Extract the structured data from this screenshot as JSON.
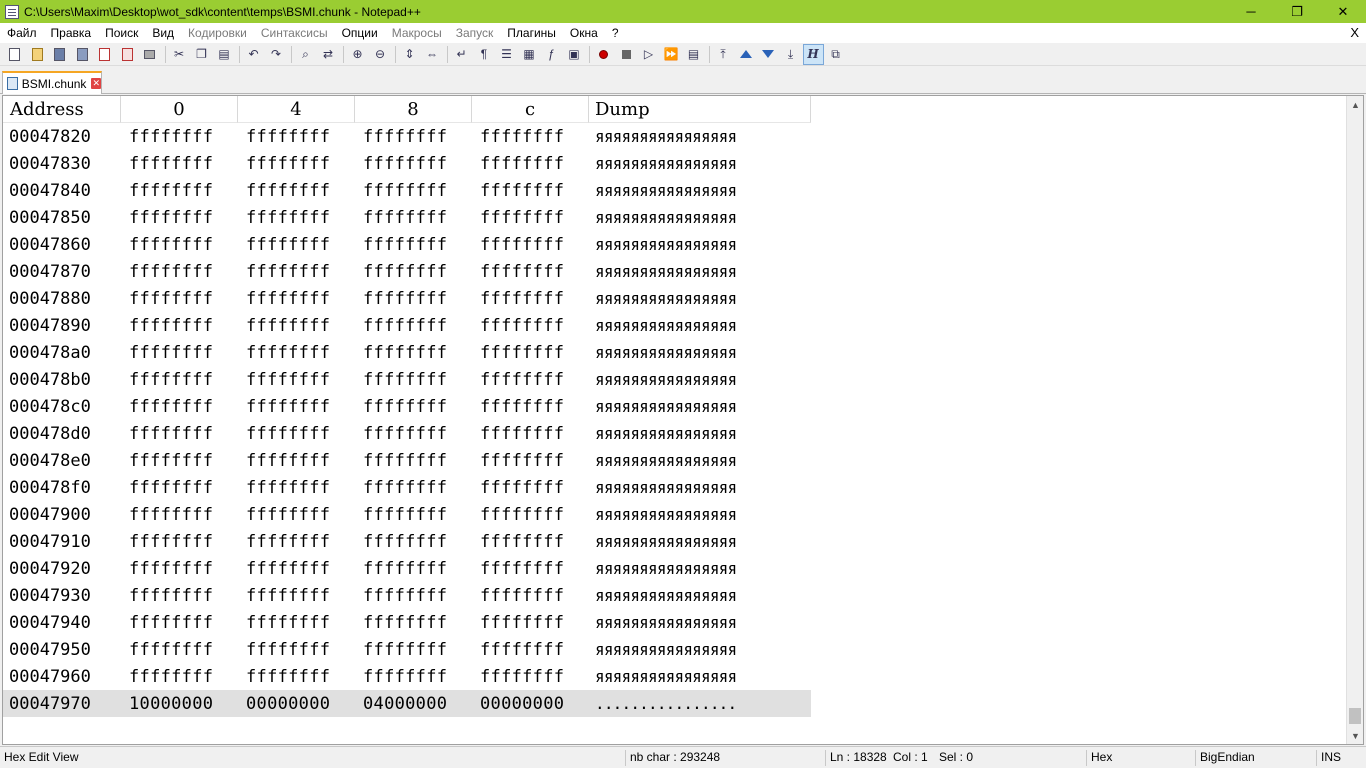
{
  "window": {
    "title": "C:\\Users\\Maxim\\Desktop\\wot_sdk\\content\\temps\\BSMI.chunk - Notepad++",
    "minimize": "─",
    "maximize": "❐",
    "close": "✕"
  },
  "menu": {
    "items": [
      {
        "label": "Файл",
        "enabled": true
      },
      {
        "label": "Правка",
        "enabled": true
      },
      {
        "label": "Поиск",
        "enabled": true
      },
      {
        "label": "Вид",
        "enabled": true
      },
      {
        "label": "Кодировки",
        "enabled": false
      },
      {
        "label": "Синтаксисы",
        "enabled": false
      },
      {
        "label": "Опции",
        "enabled": true
      },
      {
        "label": "Макросы",
        "enabled": false
      },
      {
        "label": "Запуск",
        "enabled": false
      },
      {
        "label": "Плагины",
        "enabled": true
      },
      {
        "label": "Окна",
        "enabled": true
      },
      {
        "label": "?",
        "enabled": true
      }
    ],
    "close_doc": "X"
  },
  "toolbar": {
    "icons": [
      "new-icon",
      "open-icon",
      "save-icon",
      "save-all-icon",
      "close-icon",
      "close-all-icon",
      "print-icon",
      "cut-icon",
      "copy-icon",
      "paste-icon",
      "undo-icon",
      "redo-icon",
      "find-icon",
      "replace-icon",
      "zoom-in-icon",
      "zoom-out-icon",
      "sync-vertical-icon",
      "sync-horizontal-icon",
      "word-wrap-icon",
      "show-all-chars-icon",
      "indent-guide-icon",
      "doc-map-icon",
      "function-list-icon",
      "folder-workspace-icon",
      "record-macro-icon",
      "stop-macro-icon",
      "play-macro-icon",
      "run-macro-multiple-icon",
      "save-macro-icon",
      "hex-first-icon",
      "hex-up-icon",
      "hex-down-icon",
      "hex-last-icon",
      "hex-edit-icon",
      "hex-compare-icon"
    ],
    "active": "hex-edit-icon"
  },
  "tab": {
    "label": "BSMI.chunk",
    "close": "✕"
  },
  "hex": {
    "headers": {
      "address": "Address",
      "col0": "0",
      "col4": "4",
      "col8": "8",
      "colc": "c",
      "dump": "Dump"
    },
    "rows": [
      {
        "addr": "00047820",
        "c0": "ffffffff",
        "c4": "ffffffff",
        "c8": "ffffffff",
        "cc": "ffffffff",
        "dump": "яяяяяяяяяяяяяяяя"
      },
      {
        "addr": "00047830",
        "c0": "ffffffff",
        "c4": "ffffffff",
        "c8": "ffffffff",
        "cc": "ffffffff",
        "dump": "яяяяяяяяяяяяяяяя"
      },
      {
        "addr": "00047840",
        "c0": "ffffffff",
        "c4": "ffffffff",
        "c8": "ffffffff",
        "cc": "ffffffff",
        "dump": "яяяяяяяяяяяяяяяя"
      },
      {
        "addr": "00047850",
        "c0": "ffffffff",
        "c4": "ffffffff",
        "c8": "ffffffff",
        "cc": "ffffffff",
        "dump": "яяяяяяяяяяяяяяяя"
      },
      {
        "addr": "00047860",
        "c0": "ffffffff",
        "c4": "ffffffff",
        "c8": "ffffffff",
        "cc": "ffffffff",
        "dump": "яяяяяяяяяяяяяяяя"
      },
      {
        "addr": "00047870",
        "c0": "ffffffff",
        "c4": "ffffffff",
        "c8": "ffffffff",
        "cc": "ffffffff",
        "dump": "яяяяяяяяяяяяяяяя"
      },
      {
        "addr": "00047880",
        "c0": "ffffffff",
        "c4": "ffffffff",
        "c8": "ffffffff",
        "cc": "ffffffff",
        "dump": "яяяяяяяяяяяяяяяя"
      },
      {
        "addr": "00047890",
        "c0": "ffffffff",
        "c4": "ffffffff",
        "c8": "ffffffff",
        "cc": "ffffffff",
        "dump": "яяяяяяяяяяяяяяяя"
      },
      {
        "addr": "000478a0",
        "c0": "ffffffff",
        "c4": "ffffffff",
        "c8": "ffffffff",
        "cc": "ffffffff",
        "dump": "яяяяяяяяяяяяяяяя"
      },
      {
        "addr": "000478b0",
        "c0": "ffffffff",
        "c4": "ffffffff",
        "c8": "ffffffff",
        "cc": "ffffffff",
        "dump": "яяяяяяяяяяяяяяяя"
      },
      {
        "addr": "000478c0",
        "c0": "ffffffff",
        "c4": "ffffffff",
        "c8": "ffffffff",
        "cc": "ffffffff",
        "dump": "яяяяяяяяяяяяяяяя"
      },
      {
        "addr": "000478d0",
        "c0": "ffffffff",
        "c4": "ffffffff",
        "c8": "ffffffff",
        "cc": "ffffffff",
        "dump": "яяяяяяяяяяяяяяяя"
      },
      {
        "addr": "000478e0",
        "c0": "ffffffff",
        "c4": "ffffffff",
        "c8": "ffffffff",
        "cc": "ffffffff",
        "dump": "яяяяяяяяяяяяяяяя"
      },
      {
        "addr": "000478f0",
        "c0": "ffffffff",
        "c4": "ffffffff",
        "c8": "ffffffff",
        "cc": "ffffffff",
        "dump": "яяяяяяяяяяяяяяяя"
      },
      {
        "addr": "00047900",
        "c0": "ffffffff",
        "c4": "ffffffff",
        "c8": "ffffffff",
        "cc": "ffffffff",
        "dump": "яяяяяяяяяяяяяяяя"
      },
      {
        "addr": "00047910",
        "c0": "ffffffff",
        "c4": "ffffffff",
        "c8": "ffffffff",
        "cc": "ffffffff",
        "dump": "яяяяяяяяяяяяяяяя"
      },
      {
        "addr": "00047920",
        "c0": "ffffffff",
        "c4": "ffffffff",
        "c8": "ffffffff",
        "cc": "ffffffff",
        "dump": "яяяяяяяяяяяяяяяя"
      },
      {
        "addr": "00047930",
        "c0": "ffffffff",
        "c4": "ffffffff",
        "c8": "ffffffff",
        "cc": "ffffffff",
        "dump": "яяяяяяяяяяяяяяяя"
      },
      {
        "addr": "00047940",
        "c0": "ffffffff",
        "c4": "ffffffff",
        "c8": "ffffffff",
        "cc": "ffffffff",
        "dump": "яяяяяяяяяяяяяяяя"
      },
      {
        "addr": "00047950",
        "c0": "ffffffff",
        "c4": "ffffffff",
        "c8": "ffffffff",
        "cc": "ffffffff",
        "dump": "яяяяяяяяяяяяяяяя"
      },
      {
        "addr": "00047960",
        "c0": "ffffffff",
        "c4": "ffffffff",
        "c8": "ffffffff",
        "cc": "ffffffff",
        "dump": "яяяяяяяяяяяяяяяя"
      },
      {
        "addr": "00047970",
        "c0": "10000000",
        "c4": "00000000",
        "c8": "04000000",
        "cc": "00000000",
        "dump": "................",
        "selected": true
      }
    ]
  },
  "status": {
    "mode": "Hex Edit View",
    "nb_char": "nb char : 293248",
    "ln": "Ln : 18328",
    "col": "Col : 1",
    "sel": "Sel : 0",
    "view": "Hex",
    "endian": "BigEndian",
    "ins": "INS"
  },
  "colors": {
    "titlebar": "#9acd32",
    "tab_accent": "#f5a623",
    "selected_row": "#e0e0e0"
  }
}
